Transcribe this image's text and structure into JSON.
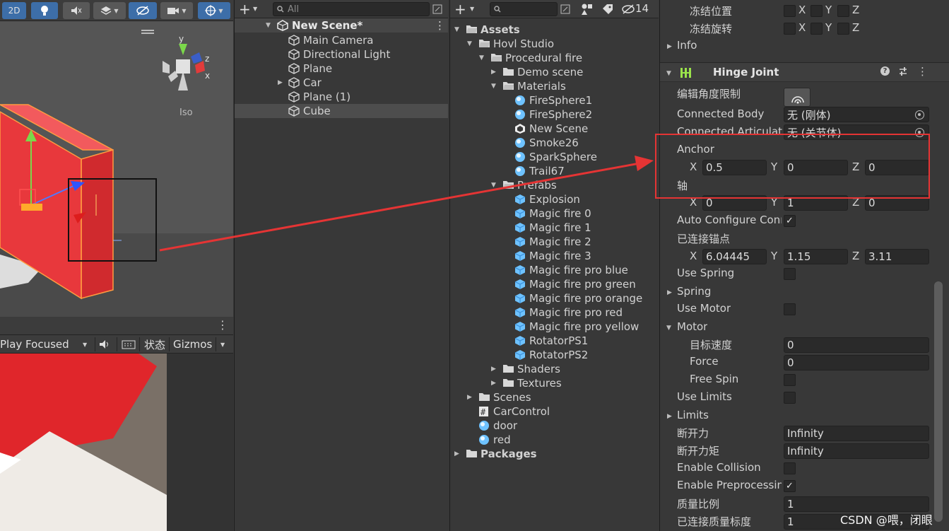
{
  "scene_view": {
    "toolbar": {
      "mode_2d": "2D"
    },
    "gizmo_axes": {
      "y": "y",
      "x": "x",
      "z": "z"
    },
    "iso_label": "Iso"
  },
  "game_view": {
    "play_mode": "Play Focused",
    "stats": "状态",
    "gizmos": "Gizmos"
  },
  "hierarchy": {
    "search_placeholder": "All",
    "scene_name": "New Scene*",
    "items": [
      "Main Camera",
      "Directional Light",
      "Plane",
      "Car",
      "Plane (1)",
      "Cube"
    ]
  },
  "project": {
    "hidden_count": "14",
    "tree": {
      "assets": "Assets",
      "hovl_studio": "Hovl Studio",
      "procedural_fire": "Procedural fire",
      "demo_scene": "Demo scene",
      "materials": "Materials",
      "material_items": [
        "FireSphere1",
        "FireSphere2",
        "New Scene",
        "Smoke26",
        "SparkSphere",
        "Trail67"
      ],
      "prefabs": "Prefabs",
      "prefab_items": [
        "Explosion",
        "Magic fire 0",
        "Magic fire 1",
        "Magic fire 2",
        "Magic fire 3",
        "Magic fire pro blue",
        "Magic fire pro green",
        "Magic fire pro orange",
        "Magic fire pro red",
        "Magic fire pro yellow",
        "RotatorPS1",
        "RotatorPS2"
      ],
      "shaders": "Shaders",
      "textures": "Textures",
      "scenes": "Scenes",
      "car_control": "CarControl",
      "door": "door",
      "red": "red",
      "packages": "Packages"
    }
  },
  "inspector": {
    "freeze_position": "冻结位置",
    "freeze_rotation": "冻结旋转",
    "axis_x": "X",
    "axis_y": "Y",
    "axis_z": "Z",
    "info": "Info",
    "component_title": "Hinge Joint",
    "edit_angular_limits": "编辑角度限制",
    "connected_body": {
      "label": "Connected Body",
      "value": "无 (刚体)"
    },
    "connected_articulation": {
      "label": "Connected Articulati",
      "value": "无 (关节体)"
    },
    "anchor": {
      "label": "Anchor",
      "x": "0.5",
      "y": "0",
      "z": "0"
    },
    "axis": {
      "label": "轴",
      "x": "0",
      "y": "1",
      "z": "0"
    },
    "auto_configure": {
      "label": "Auto Configure Conn",
      "checked": true
    },
    "connected_anchor": {
      "label": "已连接锚点",
      "x": "6.04445",
      "y": "1.15",
      "z": "3.11"
    },
    "use_spring": "Use Spring",
    "spring": "Spring",
    "use_motor": "Use Motor",
    "motor": "Motor",
    "target_velocity": {
      "label": "目标速度",
      "value": "0"
    },
    "force": {
      "label": "Force",
      "value": "0"
    },
    "free_spin": "Free Spin",
    "use_limits": "Use Limits",
    "limits": "Limits",
    "break_force": {
      "label": "断开力",
      "value": "Infinity"
    },
    "break_torque": {
      "label": "断开力矩",
      "value": "Infinity"
    },
    "enable_collision": "Enable Collision",
    "enable_preprocessing": {
      "label": "Enable Preprocessin",
      "checked": true
    },
    "mass_scale": {
      "label": "质量比例",
      "value": "1"
    },
    "connected_mass_scale": {
      "label": "已连接质量标度",
      "value": "1"
    }
  },
  "watermark": "CSDN @喂，闭眼",
  "colors": {
    "annotation_red": "#e53434",
    "selection_blue": "#3d6ea8",
    "cube_red": "#e8383c"
  }
}
